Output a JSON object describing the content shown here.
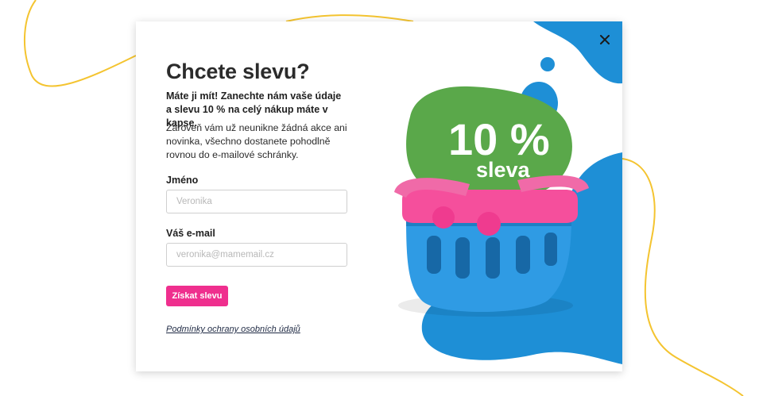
{
  "popup": {
    "title": "Chcete slevu?",
    "lead": "Máte ji mít! Zanechte nám vaše údaje a slevu 10 % na celý nákup máte v kapse.",
    "description": "Zároveň vám už neunikne žádná akce ani novinka, všechno dostanete pohodlně rovnou do e-mailové schránky.",
    "name_label": "Jméno",
    "name_placeholder": "Veronika",
    "name_value": "",
    "email_label": "Váš e-mail",
    "email_placeholder": "veronika@mamemail.cz",
    "email_value": "",
    "submit_label": "Získat slevu",
    "privacy_link": "Podmínky ochrany osobních údajů",
    "close_icon": "close-icon"
  },
  "promo": {
    "percent": "10 %",
    "word": "sleva",
    "basket_icon": "shopping-basket-icon"
  },
  "colors": {
    "accent_pink": "#ef2f8e",
    "blue": "#1e8fd6",
    "green": "#5aa84a",
    "yellow_curve": "#f4c430",
    "text_dark": "#2b2b2b"
  }
}
